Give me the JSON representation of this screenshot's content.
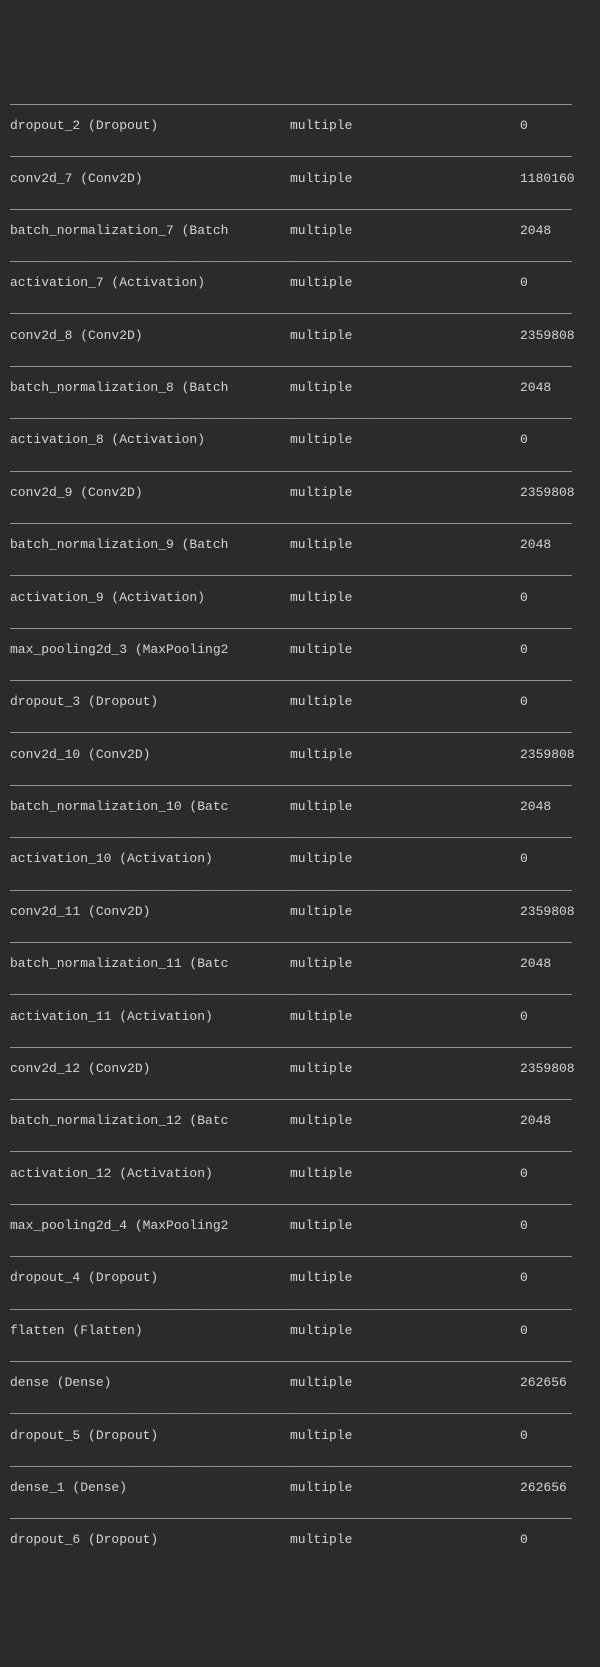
{
  "divider_line": "________________________________________________________________________",
  "layers": [
    {
      "name": "dropout_2 (Dropout)",
      "output": "multiple",
      "params": "0"
    },
    {
      "name": "conv2d_7 (Conv2D)",
      "output": "multiple",
      "params": "1180160"
    },
    {
      "name": "batch_normalization_7 (Batch",
      "output": "multiple",
      "params": "2048"
    },
    {
      "name": "activation_7 (Activation)",
      "output": "multiple",
      "params": "0"
    },
    {
      "name": "conv2d_8 (Conv2D)",
      "output": "multiple",
      "params": "2359808"
    },
    {
      "name": "batch_normalization_8 (Batch",
      "output": "multiple",
      "params": "2048"
    },
    {
      "name": "activation_8 (Activation)",
      "output": "multiple",
      "params": "0"
    },
    {
      "name": "conv2d_9 (Conv2D)",
      "output": "multiple",
      "params": "2359808"
    },
    {
      "name": "batch_normalization_9 (Batch",
      "output": "multiple",
      "params": "2048"
    },
    {
      "name": "activation_9 (Activation)",
      "output": "multiple",
      "params": "0"
    },
    {
      "name": "max_pooling2d_3 (MaxPooling2",
      "output": "multiple",
      "params": "0"
    },
    {
      "name": "dropout_3 (Dropout)",
      "output": "multiple",
      "params": "0"
    },
    {
      "name": "conv2d_10 (Conv2D)",
      "output": "multiple",
      "params": "2359808"
    },
    {
      "name": "batch_normalization_10 (Batc",
      "output": "multiple",
      "params": "2048"
    },
    {
      "name": "activation_10 (Activation)",
      "output": "multiple",
      "params": "0"
    },
    {
      "name": "conv2d_11 (Conv2D)",
      "output": "multiple",
      "params": "2359808"
    },
    {
      "name": "batch_normalization_11 (Batc",
      "output": "multiple",
      "params": "2048"
    },
    {
      "name": "activation_11 (Activation)",
      "output": "multiple",
      "params": "0"
    },
    {
      "name": "conv2d_12 (Conv2D)",
      "output": "multiple",
      "params": "2359808"
    },
    {
      "name": "batch_normalization_12 (Batc",
      "output": "multiple",
      "params": "2048"
    },
    {
      "name": "activation_12 (Activation)",
      "output": "multiple",
      "params": "0"
    },
    {
      "name": "max_pooling2d_4 (MaxPooling2",
      "output": "multiple",
      "params": "0"
    },
    {
      "name": "dropout_4 (Dropout)",
      "output": "multiple",
      "params": "0"
    },
    {
      "name": "flatten (Flatten)",
      "output": "multiple",
      "params": "0"
    },
    {
      "name": "dense (Dense)",
      "output": "multiple",
      "params": "262656"
    },
    {
      "name": "dropout_5 (Dropout)",
      "output": "multiple",
      "params": "0"
    },
    {
      "name": "dense_1 (Dense)",
      "output": "multiple",
      "params": "262656"
    },
    {
      "name": "dropout_6 (Dropout)",
      "output": "multiple",
      "params": "0"
    }
  ]
}
